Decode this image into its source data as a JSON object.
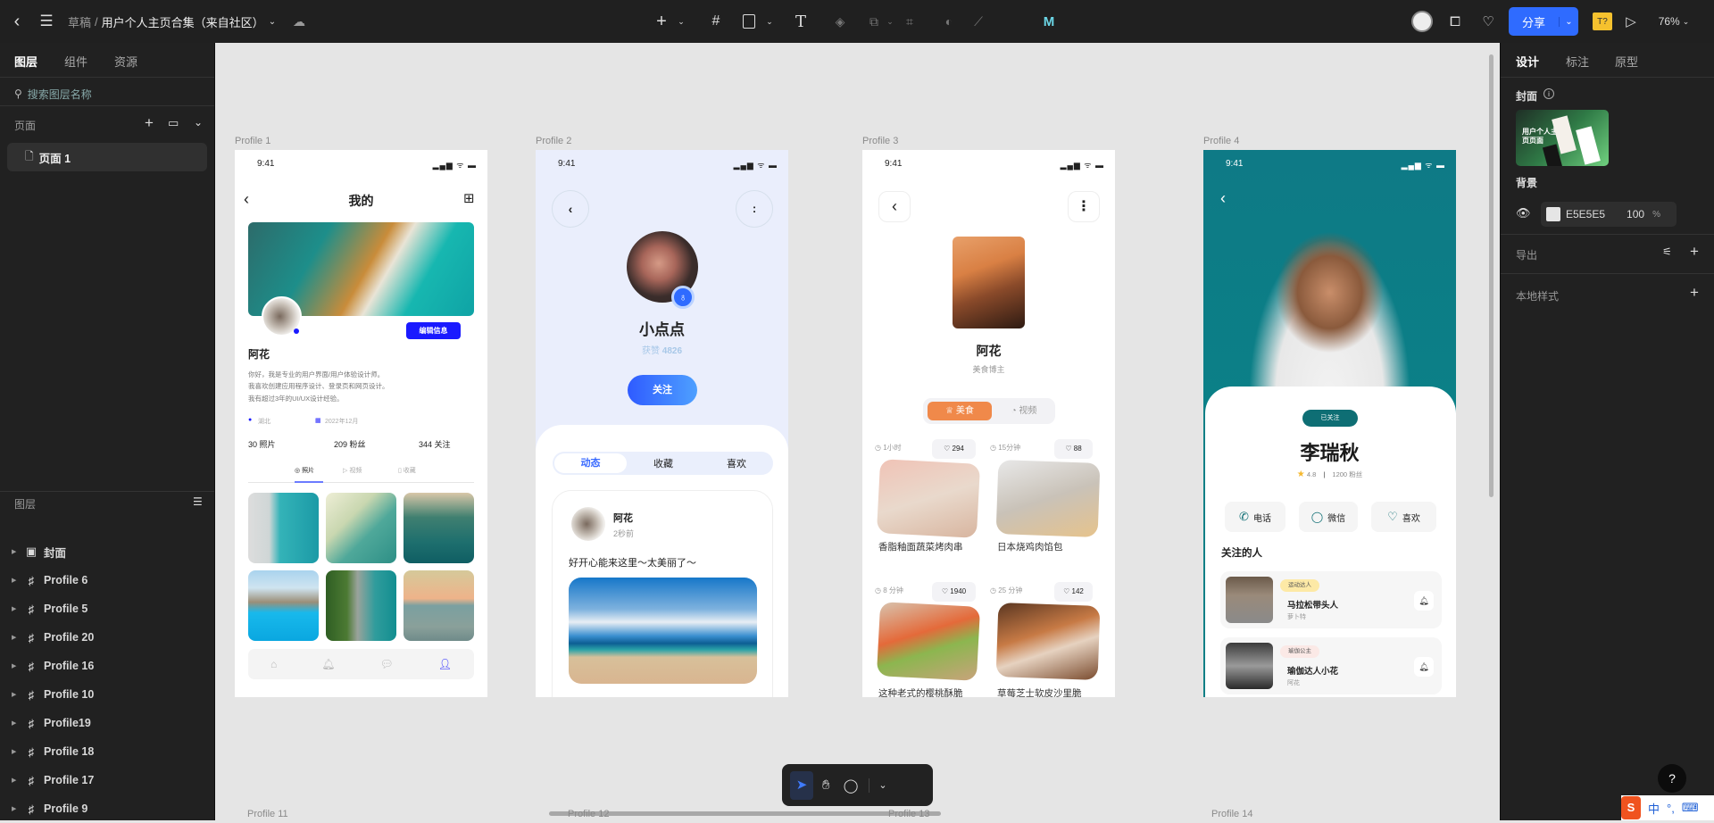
{
  "topbar": {
    "breadcrumb_parent": "草稿",
    "breadcrumb_sep": "/",
    "file_name": "用户个人主页合集（来自社区）",
    "share_label": "分享",
    "zoom": "76%",
    "font_badge": "T?"
  },
  "left_panel": {
    "tabs": [
      "图层",
      "组件",
      "资源"
    ],
    "search_placeholder": "搜索图层名称",
    "pages_title": "页面",
    "pages": [
      "页面 1"
    ],
    "layers_title": "图层",
    "layers": [
      {
        "label": "封面",
        "icon": "section-icon"
      },
      {
        "label": "Profile 6",
        "icon": "frame-icon"
      },
      {
        "label": "Profile 5",
        "icon": "frame-icon"
      },
      {
        "label": "Profile 20",
        "icon": "frame-icon"
      },
      {
        "label": "Profile 16",
        "icon": "frame-icon"
      },
      {
        "label": "Profile 10",
        "icon": "frame-icon"
      },
      {
        "label": "Profile19",
        "icon": "frame-icon"
      },
      {
        "label": "Profile 18",
        "icon": "frame-icon"
      },
      {
        "label": "Profile 17",
        "icon": "frame-icon"
      },
      {
        "label": "Profile 9",
        "icon": "frame-icon"
      }
    ]
  },
  "right_panel": {
    "tabs": [
      "设计",
      "标注",
      "原型"
    ],
    "cover_title": "封面",
    "cover_thumb_text": "用户个人主页页面",
    "background_title": "背景",
    "bg_color": "E5E5E5",
    "bg_opacity": "100",
    "bg_opacity_unit": "%",
    "export_title": "导出",
    "local_styles_title": "本地样式"
  },
  "canvas": {
    "background": "#E5E5E5",
    "frame_labels": [
      "Profile 1",
      "Profile 2",
      "Profile 3",
      "Profile 4"
    ],
    "bottom_labels": [
      "Profile 11",
      "Profile 12",
      "Profile 13",
      "Profile 14"
    ]
  },
  "profile1": {
    "time": "9:41",
    "title": "我的",
    "edit_button": "编辑信息",
    "name": "阿花",
    "bio": [
      "你好，我是专业的用户界面/用户体验设计师。",
      "我喜欢创建应用程序设计、登录页和网页设计。",
      "我有超过3年的UI/UX设计经验。"
    ],
    "location": "湖北",
    "joined": "2022年12月",
    "stats": [
      "30 照片",
      "209 粉丝",
      "344 关注"
    ],
    "tabs": [
      "照片",
      "视频",
      "收藏"
    ],
    "accent": "#1A1AFF"
  },
  "profile2": {
    "time": "9:41",
    "name": "小点点",
    "likes_label": "获赞",
    "likes_value": "4826",
    "follow_button": "关注",
    "tabs": [
      "动态",
      "收藏",
      "喜欢"
    ],
    "post": {
      "author": "阿花",
      "time": "2秒前",
      "text": "好开心能来这里～太美丽了～"
    }
  },
  "profile3": {
    "time": "9:41",
    "name": "阿花",
    "subtitle": "美食博主",
    "segments": [
      "美食",
      "视频"
    ],
    "accent": "#F0894A",
    "recipes": [
      {
        "time": "1小时",
        "likes": "294",
        "title": "香脂釉面蔬菜烤肉串"
      },
      {
        "time": "15分钟",
        "likes": "88",
        "title": "日本烧鸡肉馅包"
      },
      {
        "time": "8 分钟",
        "likes": "1940",
        "title": "这种老式的樱桃酥脆"
      },
      {
        "time": "25 分钟",
        "likes": "142",
        "title": "草莓芝士软皮沙里脆"
      }
    ]
  },
  "profile4": {
    "time": "9:41",
    "followed_badge": "已关注",
    "name": "李瑞秋",
    "rating": "4.8",
    "fans": "1200 粉丝",
    "actions": [
      "电话",
      "微信",
      "喜欢"
    ],
    "following_title": "关注的人",
    "following": [
      {
        "tag": "运动达人",
        "title": "马拉松带头人",
        "sub": "萝卜特"
      },
      {
        "tag": "瑜伽公主",
        "title": "瑜伽达人小花",
        "sub": "阿花"
      }
    ],
    "accent": "#0E6E74"
  },
  "ime": {
    "label": "中"
  },
  "help": "?"
}
